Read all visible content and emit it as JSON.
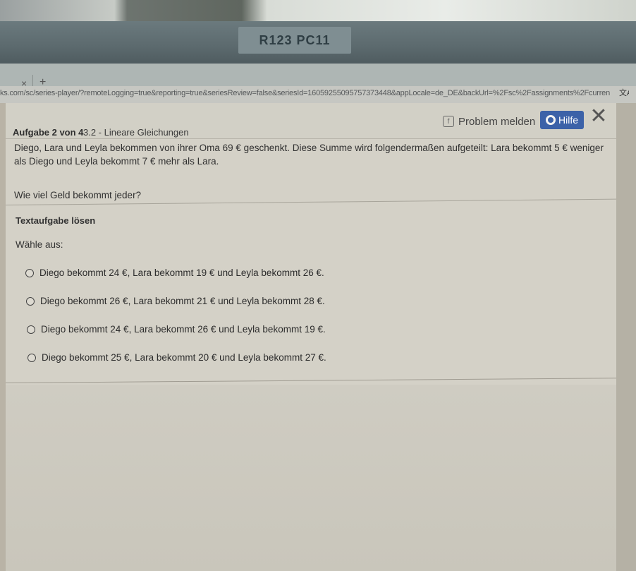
{
  "monitor": {
    "label": "R123  PC11"
  },
  "browser": {
    "tab_close": "×",
    "tab_plus": "+",
    "url": "ks.com/sc/series-player/?remoteLogging=true&reporting=true&seriesReview=false&seriesId=16059255095757373448&appLocale=de_DE&backUrl=%2Fsc%2Fassignments%2Fcurren",
    "translate_icon": "translate-icon"
  },
  "header": {
    "task": "Aufgabe 2 von 4",
    "topic": "3.2 - Lineare Gleichungen",
    "report_label": "Problem melden",
    "help_label": "Hilfe",
    "close_symbol": "✕"
  },
  "question": {
    "text": "Diego, Lara und Leyla bekommen von ihrer Oma 69 € geschenkt. Diese Summe wird folgendermaßen aufgeteilt: Lara bekommt 5 € weniger als Diego und Leyla bekommt 7 € mehr als Lara.",
    "ask": "Wie viel Geld bekommt jeder?"
  },
  "answer": {
    "section_title": "Textaufgabe lösen",
    "choose_label": "Wähle aus:",
    "options": [
      "Diego bekommt 24 €, Lara bekommt 19 € und Leyla bekommt 26 €.",
      "Diego bekommt 26 €, Lara bekommt 21 € und Leyla bekommt 28 €.",
      "Diego bekommt 24 €, Lara bekommt 26 € und Leyla bekommt 19 €.",
      "Diego bekommt 25 €, Lara bekommt 20 € und Leyla bekommt 27 €."
    ]
  },
  "colors": {
    "help_button": "#3c62a8",
    "page_bg": "#d4d1c7"
  }
}
